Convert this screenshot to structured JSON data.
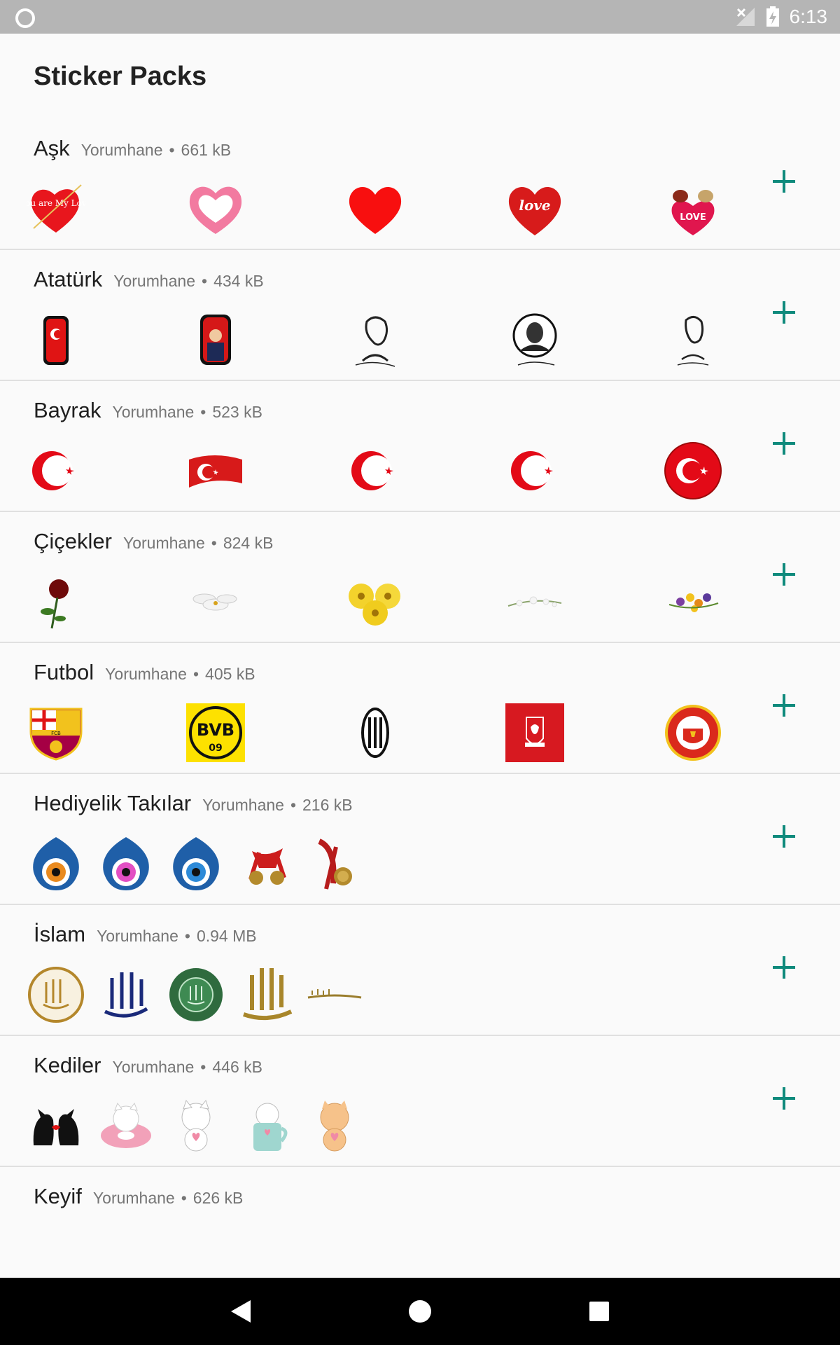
{
  "status": {
    "time": "6:13"
  },
  "title": "Sticker Packs",
  "packs": [
    {
      "name": "Aşk",
      "publisher": "Yorumhane",
      "size": "661 kB"
    },
    {
      "name": "Atatürk",
      "publisher": "Yorumhane",
      "size": "434 kB"
    },
    {
      "name": "Bayrak",
      "publisher": "Yorumhane",
      "size": "523 kB"
    },
    {
      "name": "Çiçekler",
      "publisher": "Yorumhane",
      "size": "824 kB"
    },
    {
      "name": "Futbol",
      "publisher": "Yorumhane",
      "size": "405 kB"
    },
    {
      "name": "Hediyelik Takılar",
      "publisher": "Yorumhane",
      "size": "216 kB"
    },
    {
      "name": "İslam",
      "publisher": "Yorumhane",
      "size": "0.94 MB"
    },
    {
      "name": "Kediler",
      "publisher": "Yorumhane",
      "size": "446 kB"
    },
    {
      "name": "Keyif",
      "publisher": "Yorumhane",
      "size": "626 kB"
    }
  ],
  "sticker_text": {
    "you_are_my_love": "You are My Love",
    "love": "love",
    "love_you": "LOVE",
    "bvb": "BVB",
    "bvb_09": "09",
    "fcb": "FCB"
  },
  "colors": {
    "accent": "#0f8a7c",
    "heart": "#f80f0f",
    "flag": "#e30a17"
  }
}
